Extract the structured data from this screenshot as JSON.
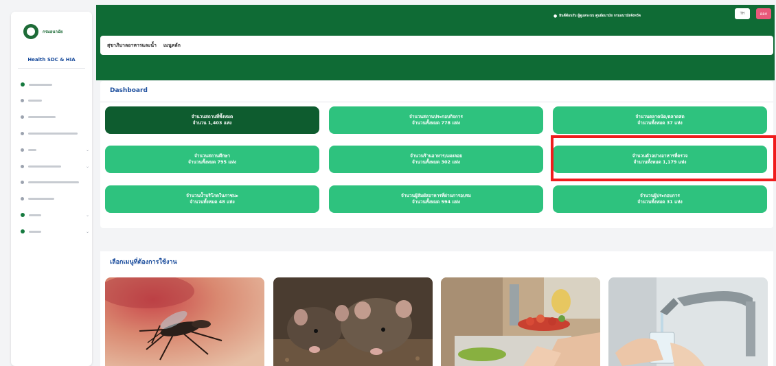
{
  "sidebar": {
    "logo_text": "กรมอนามัย",
    "brand": "Health SDC & HIA",
    "items": [
      {
        "label": "ผู้ใช้งาน/สิทธิ์งาน",
        "icon": "user-icon",
        "has_chevron": false
      },
      {
        "label": "หน้าหลัก",
        "icon": "home-icon",
        "has_chevron": false
      },
      {
        "label": "Dashboard ข้อมูล",
        "icon": "chart-icon",
        "has_chevron": false
      },
      {
        "label": "Dashboard ข้อมูลที่ต้องดำเนินการ",
        "icon": "list-icon",
        "has_chevron": false
      },
      {
        "label": "ข้อมูล",
        "icon": "document-icon",
        "has_chevron": true
      },
      {
        "label": "เครื่องมือและรายงาน",
        "icon": "tools-icon",
        "has_chevron": true
      },
      {
        "label": "สถานประกอบการที่ต้องรายงาน",
        "icon": "building-icon",
        "has_chevron": false
      },
      {
        "label": "คู่มือการใช้งาน",
        "icon": "book-icon",
        "has_chevron": false
      },
      {
        "label": "ตั้งค่า",
        "icon": "gear-icon",
        "has_chevron": true
      },
      {
        "label": "อื่นๆ",
        "icon": "more-icon",
        "has_chevron": true
      }
    ]
  },
  "header": {
    "user_text": "ยินดีต้อนรับ ผู้ดูแลระบบ ศูนย์อนามัย กรมอนามัยจังหวัด",
    "lang_label": "TH",
    "logout_label": "ออก"
  },
  "breadcrumb": {
    "section": "สุขาภิบาลอาหารและน้ำ",
    "page": "เมนูหลัก"
  },
  "dashboard": {
    "title": "Dashboard",
    "tiles": [
      {
        "line1": "จำนวนสถานที่ทั้งหมด",
        "line2": "จำนวน 1,403 แห่ง",
        "dark": true
      },
      {
        "line1": "จำนวนสถานประกอบกิจการ",
        "line2": "จำนวนทั้งหมด 778 แห่ง",
        "dark": false
      },
      {
        "line1": "จำนวนตลาดนัด/ตลาดสด",
        "line2": "จำนวนทั้งหมด 37 แห่ง",
        "dark": false
      },
      {
        "line1": "จำนวนสถานศึกษา",
        "line2": "จำนวนทั้งหมด 795 แห่ง",
        "dark": false
      },
      {
        "line1": "จำนวนร้านอาหาร/แผงลอย",
        "line2": "จำนวนทั้งหมด 302 แห่ง",
        "dark": false
      },
      {
        "line1": "จำนวนตัวอย่างอาหารที่ตรวจ",
        "line2": "จำนวนทั้งหมด 1,179 แห่ง",
        "dark": false
      },
      {
        "line1": "จำนวนน้ำบริโภคในภาชนะ",
        "line2": "จำนวนทั้งหมด 48 แห่ง",
        "dark": false
      },
      {
        "line1": "จำนวนผู้สัมผัสอาหารที่ผ่านการอบรม",
        "line2": "จำนวนทั้งหมด 594 แห่ง",
        "dark": false
      },
      {
        "line1": "จำนวนผู้ประกอบการ",
        "line2": "จำนวนทั้งหมด 31 แห่ง",
        "dark": false
      }
    ]
  },
  "menu": {
    "title": "เลือกเมนูที่ต้องการใช้งาน",
    "cards": [
      {
        "name": "mosquito-card"
      },
      {
        "name": "rat-card"
      },
      {
        "name": "food-sanitation-card"
      },
      {
        "name": "water-card"
      }
    ]
  },
  "colors": {
    "header_green": "#0f6b35",
    "tile_green": "#2ec27e",
    "tile_dark": "#0e5c2f",
    "highlight_red": "#ef1c1c",
    "title_blue": "#1a4c9c"
  }
}
